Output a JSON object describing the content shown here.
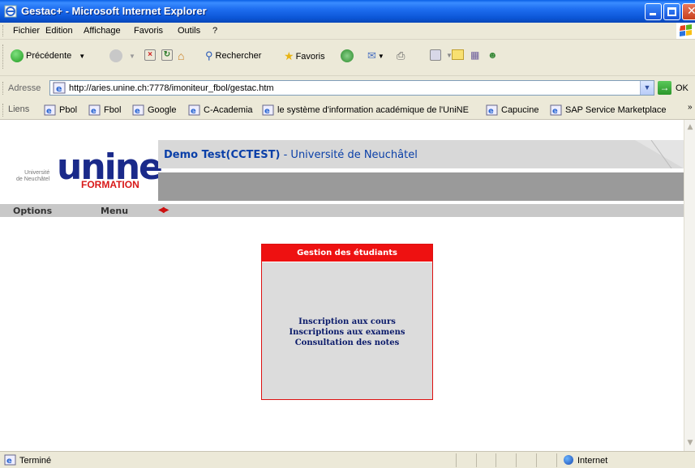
{
  "window": {
    "title": "Gestac+ - Microsoft Internet Explorer"
  },
  "menubar": {
    "items": [
      "Fichier",
      "Edition",
      "Affichage",
      "Favoris",
      "Outils",
      "?"
    ]
  },
  "toolbar": {
    "back_label": "Précédente",
    "search_label": "Rechercher",
    "favorites_label": "Favoris"
  },
  "address": {
    "label": "Adresse",
    "url": "http://aries.unine.ch:7778/imoniteur_fbol/gestac.htm",
    "go_label": "OK"
  },
  "links": {
    "label": "Liens",
    "items": [
      "Pbol",
      "Fbol",
      "Google",
      "C-Academia",
      "le système d'information académique de l'UniNE",
      "Capucine",
      "SAP Service Marketplace"
    ]
  },
  "page": {
    "logo_small": "Université\nde Neuchâtel",
    "logo_text": "unine",
    "logo_subtext": "FORMATION",
    "banner_bold": "Demo Test(CCTEST)",
    "banner_rest": " - Université de Neuchâtel",
    "nav": {
      "options_label": "Options",
      "menu_label": "Menu"
    }
  },
  "panel": {
    "title": "Gestion des étudiants",
    "links": [
      "Inscription aux cours",
      "Inscriptions aux examens",
      "Consultation des notes"
    ]
  },
  "statusbar": {
    "status": "Terminé",
    "zone": "Internet"
  }
}
